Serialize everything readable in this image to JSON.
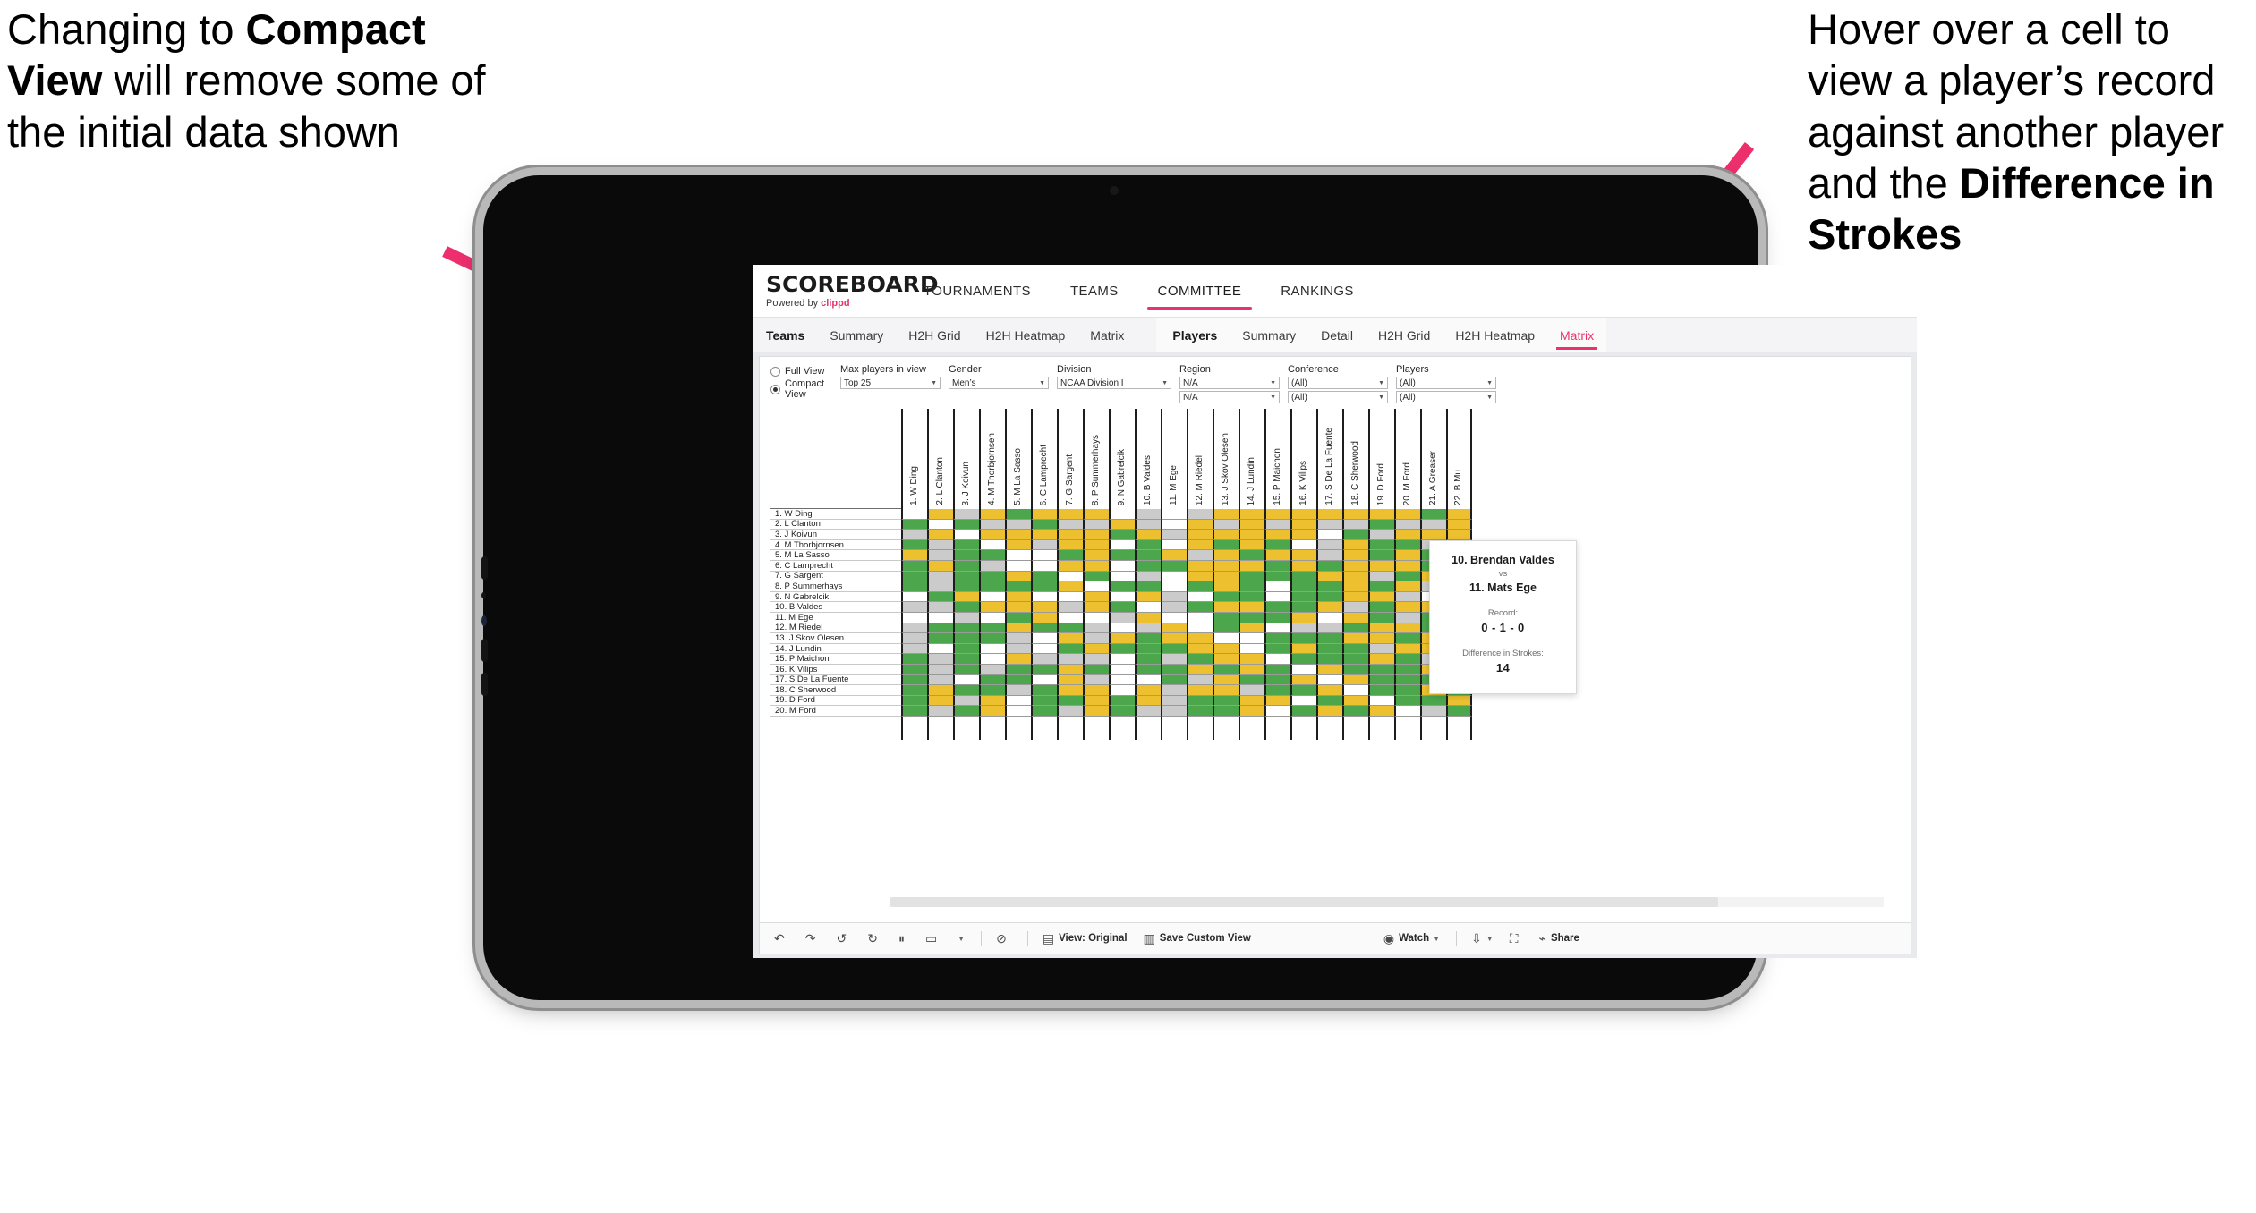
{
  "callouts": {
    "left": {
      "line1": "Changing to ",
      "bold": "Compact View",
      "line2": " will remove some of the initial data shown"
    },
    "right": {
      "line1": "Hover over a cell to view a player’s record against another player and the ",
      "bold": "Difference in Strokes"
    }
  },
  "app": {
    "logo": "SCOREBOARD",
    "logo_sub_prefix": "Powered by ",
    "logo_sub_brand": "clippd",
    "topnav": [
      {
        "label": "TOURNAMENTS",
        "active": false
      },
      {
        "label": "TEAMS",
        "active": false
      },
      {
        "label": "COMMITTEE",
        "active": true
      },
      {
        "label": "RANKINGS",
        "active": false
      }
    ],
    "subnav_teams": [
      {
        "label": "Teams",
        "lead": true,
        "active": false
      },
      {
        "label": "Summary",
        "lead": false,
        "active": false
      },
      {
        "label": "H2H Grid",
        "lead": false,
        "active": false
      },
      {
        "label": "H2H Heatmap",
        "lead": false,
        "active": false
      },
      {
        "label": "Matrix",
        "lead": false,
        "active": false
      }
    ],
    "subnav_players": [
      {
        "label": "Players",
        "lead": true,
        "active": false
      },
      {
        "label": "Summary",
        "lead": false,
        "active": false
      },
      {
        "label": "Detail",
        "lead": false,
        "active": false
      },
      {
        "label": "H2H Grid",
        "lead": false,
        "active": false
      },
      {
        "label": "H2H Heatmap",
        "lead": false,
        "active": false
      },
      {
        "label": "Matrix",
        "lead": false,
        "active": true
      }
    ]
  },
  "filters": {
    "view_options": [
      {
        "label": "Full View",
        "selected": false
      },
      {
        "label": "Compact View",
        "selected": true
      }
    ],
    "selects": [
      {
        "label": "Max players in view",
        "value": "Top 25",
        "value2": null
      },
      {
        "label": "Gender",
        "value": "Men’s",
        "value2": null
      },
      {
        "label": "Division",
        "value": "NCAA Division I",
        "value2": null
      },
      {
        "label": "Region",
        "value": "N/A",
        "value2": "N/A"
      },
      {
        "label": "Conference",
        "value": "(All)",
        "value2": "(All)"
      },
      {
        "label": "Players",
        "value": "(All)",
        "value2": "(All)"
      }
    ]
  },
  "matrix": {
    "columns": [
      "1. W Ding",
      "2. L Clanton",
      "3. J Koivun",
      "4. M Thorbjornsen",
      "5. M La Sasso",
      "6. C Lamprecht",
      "7. G Sargent",
      "8. P Summerhays",
      "9. N Gabrelcik",
      "10. B Valdes",
      "11. M Ege",
      "12. M Riedel",
      "13. J Skov Olesen",
      "14. J Lundin",
      "15. P Maichon",
      "16. K Vilips",
      "17. S De La Fuente",
      "18. C Sherwood",
      "19. D Ford",
      "20. M Ford",
      "21. A Greaser",
      "22. B Mu"
    ],
    "rows": [
      "1. W Ding",
      "2. L Clanton",
      "3. J Koivun",
      "4. M Thorbjornsen",
      "5. M La Sasso",
      "6. C Lamprecht",
      "7. G Sargent",
      "8. P Summerhays",
      "9. N Gabrelcik",
      "10. B Valdes",
      "11. M Ege",
      "12. M Riedel",
      "13. J Skov Olesen",
      "14. J Lundin",
      "15. P Maichon",
      "16. K Vilips",
      "17. S De La Fuente",
      "18. C Sherwood",
      "19. D Ford",
      "20. M Ford"
    ],
    "legend": {
      "win": "#4ca64c",
      "tie": "#ecc02f",
      "loss": "#cbcbcb",
      "self": "#ffffff"
    },
    "cells": [
      [
        "w",
        "y",
        "g",
        "y",
        "n",
        "y",
        "y",
        "y",
        "w",
        "g",
        "w",
        "g",
        "y",
        "y",
        "y",
        "y",
        "y",
        "y",
        "y",
        "y",
        "n",
        "y"
      ],
      [
        "n",
        "w",
        "n",
        "g",
        "g",
        "n",
        "g",
        "g",
        "y",
        "g",
        "w",
        "y",
        "g",
        "y",
        "g",
        "y",
        "g",
        "g",
        "n",
        "g",
        "g",
        "y"
      ],
      [
        "g",
        "y",
        "w",
        "y",
        "y",
        "y",
        "y",
        "y",
        "n",
        "y",
        "g",
        "y",
        "y",
        "y",
        "y",
        "y",
        "w",
        "n",
        "g",
        "y",
        "y",
        "y"
      ],
      [
        "n",
        "g",
        "n",
        "w",
        "y",
        "g",
        "y",
        "y",
        "w",
        "n",
        "w",
        "y",
        "n",
        "y",
        "n",
        "w",
        "g",
        "y",
        "n",
        "n",
        "g",
        "y"
      ],
      [
        "y",
        "g",
        "n",
        "n",
        "w",
        "w",
        "n",
        "y",
        "n",
        "n",
        "y",
        "g",
        "y",
        "n",
        "y",
        "y",
        "g",
        "y",
        "n",
        "y",
        "n",
        "n"
      ],
      [
        "n",
        "y",
        "n",
        "g",
        "w",
        "w",
        "y",
        "y",
        "w",
        "n",
        "n",
        "y",
        "y",
        "y",
        "n",
        "y",
        "n",
        "y",
        "y",
        "y",
        "n",
        "y"
      ],
      [
        "n",
        "g",
        "n",
        "n",
        "y",
        "n",
        "w",
        "n",
        "w",
        "g",
        "w",
        "y",
        "y",
        "n",
        "n",
        "n",
        "y",
        "y",
        "g",
        "n",
        "y",
        "n"
      ],
      [
        "n",
        "g",
        "n",
        "n",
        "n",
        "n",
        "y",
        "w",
        "n",
        "n",
        "w",
        "n",
        "y",
        "n",
        "w",
        "n",
        "n",
        "y",
        "n",
        "y",
        "g",
        "n"
      ],
      [
        "w",
        "n",
        "y",
        "w",
        "y",
        "w",
        "w",
        "y",
        "w",
        "y",
        "g",
        "w",
        "n",
        "n",
        "w",
        "n",
        "n",
        "y",
        "y",
        "g",
        "w",
        "y"
      ],
      [
        "g",
        "g",
        "n",
        "y",
        "y",
        "y",
        "g",
        "y",
        "n",
        "w",
        "g",
        "n",
        "y",
        "y",
        "n",
        "n",
        "y",
        "g",
        "n",
        "y",
        "y",
        "n"
      ],
      [
        "w",
        "w",
        "g",
        "w",
        "n",
        "y",
        "w",
        "w",
        "g",
        "y",
        "w",
        "w",
        "n",
        "n",
        "n",
        "y",
        "w",
        "y",
        "n",
        "g",
        "n",
        "y"
      ],
      [
        "g",
        "n",
        "n",
        "n",
        "y",
        "n",
        "n",
        "g",
        "w",
        "g",
        "y",
        "w",
        "n",
        "y",
        "w",
        "g",
        "g",
        "n",
        "y",
        "y",
        "n",
        "n"
      ],
      [
        "g",
        "n",
        "n",
        "n",
        "g",
        "w",
        "y",
        "g",
        "y",
        "n",
        "y",
        "y",
        "w",
        "w",
        "n",
        "n",
        "n",
        "y",
        "y",
        "n",
        "y",
        "g"
      ],
      [
        "g",
        "w",
        "n",
        "w",
        "g",
        "w",
        "n",
        "y",
        "n",
        "n",
        "n",
        "y",
        "y",
        "w",
        "n",
        "y",
        "n",
        "n",
        "g",
        "y",
        "y",
        "y"
      ],
      [
        "n",
        "g",
        "n",
        "w",
        "y",
        "g",
        "g",
        "g",
        "w",
        "n",
        "g",
        "n",
        "y",
        "y",
        "w",
        "n",
        "n",
        "n",
        "y",
        "n",
        "g",
        "n"
      ],
      [
        "n",
        "g",
        "n",
        "g",
        "n",
        "n",
        "y",
        "n",
        "w",
        "n",
        "n",
        "y",
        "n",
        "y",
        "n",
        "w",
        "y",
        "n",
        "n",
        "n",
        "y",
        "y"
      ],
      [
        "n",
        "g",
        "w",
        "n",
        "n",
        "w",
        "y",
        "g",
        "w",
        "w",
        "n",
        "g",
        "y",
        "n",
        "n",
        "y",
        "w",
        "y",
        "n",
        "n",
        "n",
        "n"
      ],
      [
        "n",
        "y",
        "n",
        "n",
        "g",
        "n",
        "y",
        "y",
        "w",
        "y",
        "g",
        "y",
        "y",
        "g",
        "n",
        "n",
        "y",
        "w",
        "n",
        "n",
        "y",
        "n"
      ],
      [
        "n",
        "y",
        "g",
        "y",
        "w",
        "n",
        "n",
        "y",
        "n",
        "y",
        "g",
        "n",
        "n",
        "y",
        "y",
        "w",
        "n",
        "y",
        "w",
        "n",
        "n",
        "y"
      ],
      [
        "n",
        "g",
        "n",
        "y",
        "w",
        "n",
        "g",
        "y",
        "n",
        "g",
        "g",
        "n",
        "n",
        "y",
        "w",
        "n",
        "y",
        "n",
        "y",
        "w",
        "g",
        "n"
      ]
    ]
  },
  "tooltip": {
    "player_a": "10. Brendan Valdes",
    "vs": "vs",
    "player_b": "11. Mats Ege",
    "record_label": "Record:",
    "record_value": "0 - 1 - 0",
    "diff_label": "Difference in Strokes:",
    "diff_value": "14"
  },
  "toolbar": {
    "icons": [
      {
        "name": "undo-icon",
        "glyph": "↶"
      },
      {
        "name": "redo-icon",
        "glyph": "↷"
      },
      {
        "name": "revert-icon",
        "glyph": "↺"
      },
      {
        "name": "refresh-data-icon",
        "glyph": "↻"
      },
      {
        "name": "pause-refresh-icon",
        "glyph": "⏸"
      },
      {
        "name": "pause-auto-update-icon",
        "glyph": "▭"
      }
    ],
    "help_glyph": "⊘",
    "view_label": "View: Original",
    "save_label": "Save Custom View",
    "watch_label": "Watch",
    "download_glyph": "⇩",
    "fullscreen_glyph": "⛶",
    "share_label": "Share"
  }
}
